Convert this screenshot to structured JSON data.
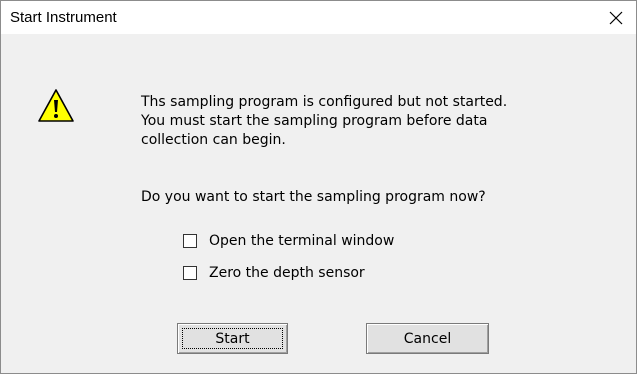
{
  "window": {
    "title": "Start Instrument",
    "close_icon": "close-icon"
  },
  "icon": {
    "name": "warning-icon",
    "fill": "#ffff00",
    "stroke": "#000000"
  },
  "message": {
    "lines": [
      "Ths sampling program is configured but not started.",
      "You must start the sampling program before data",
      "collection can begin."
    ],
    "question": "Do you want to start the sampling program now?"
  },
  "options": [
    {
      "label": "Open the terminal window",
      "checked": false
    },
    {
      "label": "Zero the depth sensor",
      "checked": false
    }
  ],
  "buttons": {
    "start_label": "Start",
    "cancel_label": "Cancel"
  }
}
